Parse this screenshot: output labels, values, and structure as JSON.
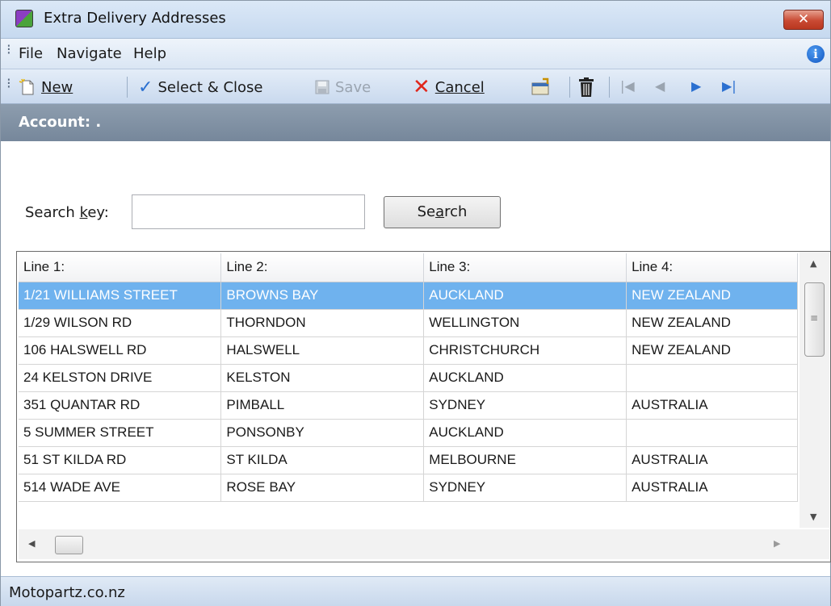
{
  "window": {
    "title": "Extra Delivery Addresses",
    "close_label": "✕"
  },
  "menu": {
    "items": [
      "File",
      "Navigate",
      "Help"
    ]
  },
  "toolbar": {
    "new_label": "New",
    "select_close_label": "Select & Close",
    "save_label": "Save",
    "cancel_label": "Cancel"
  },
  "account": {
    "label": "Account: ."
  },
  "search": {
    "label": "Search key:",
    "value": "",
    "placeholder": "",
    "button_label": "Search"
  },
  "grid": {
    "columns": [
      "Line 1:",
      "Line 2:",
      "Line 3:",
      "Line 4:"
    ],
    "selected_row": 0,
    "rows": [
      [
        "1/21 WILLIAMS STREET",
        "BROWNS BAY",
        "AUCKLAND",
        "NEW ZEALAND"
      ],
      [
        "1/29 WILSON RD",
        "THORNDON",
        "WELLINGTON",
        "NEW ZEALAND"
      ],
      [
        "106 HALSWELL RD",
        "HALSWELL",
        "CHRISTCHURCH",
        "NEW ZEALAND"
      ],
      [
        "24 KELSTON DRIVE",
        "KELSTON",
        "AUCKLAND",
        ""
      ],
      [
        "351 QUANTAR RD",
        "PIMBALL",
        "SYDNEY",
        "AUSTRALIA"
      ],
      [
        "5 SUMMER STREET",
        "PONSONBY",
        "AUCKLAND",
        ""
      ],
      [
        "51 ST KILDA RD",
        "ST KILDA",
        "MELBOURNE",
        "AUSTRALIA"
      ],
      [
        "514 WADE AVE",
        "ROSE BAY",
        "SYDNEY",
        "AUSTRALIA"
      ]
    ]
  },
  "status": {
    "text": "Motopartz.co.nz"
  },
  "colors": {
    "selection": "#6fb2ee",
    "account_bar": "#7f8fa2",
    "close_button": "#c94a33"
  }
}
